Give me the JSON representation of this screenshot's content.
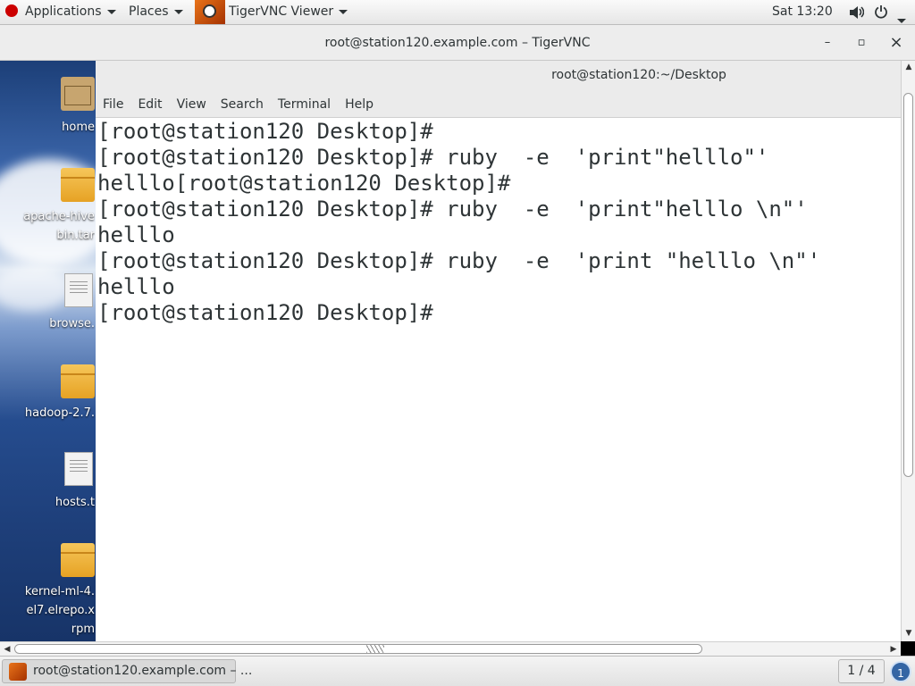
{
  "topbar": {
    "applications": "Applications",
    "places": "Places",
    "app_name": "TigerVNC Viewer",
    "clock": "Sat 13:20",
    "icons": [
      "redhat-icon",
      "tigervnc-icon",
      "volume-icon",
      "power-icon"
    ]
  },
  "window": {
    "title": "root@station120.example.com – TigerVNC",
    "minimize": "–",
    "maximize": "▫",
    "close": "×"
  },
  "desktop": {
    "icons": [
      {
        "label": "home",
        "icon": "home-folder-icon"
      },
      {
        "label": "apache-hive",
        "label2": "bin.tar",
        "icon": "archive-icon"
      },
      {
        "label": "browse.",
        "icon": "text-file-icon"
      },
      {
        "label": "hadoop-2.7.",
        "icon": "archive-icon"
      },
      {
        "label": "hosts.t",
        "icon": "text-file-icon"
      },
      {
        "label": "kernel-ml-4.",
        "label2": "el7.elrepo.x",
        "label3": "rpm",
        "icon": "archive-icon"
      }
    ]
  },
  "terminal": {
    "title": "root@station120:~/Desktop",
    "menu": [
      "File",
      "Edit",
      "View",
      "Search",
      "Terminal",
      "Help"
    ],
    "lines": [
      "[root@station120 Desktop]#",
      "[root@station120 Desktop]# ruby  -e  'print\"helllo\"'",
      "helllo[root@station120 Desktop]#",
      "[root@station120 Desktop]# ruby  -e  'print\"helllo \\n\"'",
      "helllo",
      "[root@station120 Desktop]# ruby  -e  'print \"helllo \\n\"'",
      "helllo",
      "[root@station120 Desktop]#"
    ]
  },
  "taskbar": {
    "task_label": "root@station120.example.com – ...",
    "workspace": "1 / 4",
    "notifications": "1"
  }
}
